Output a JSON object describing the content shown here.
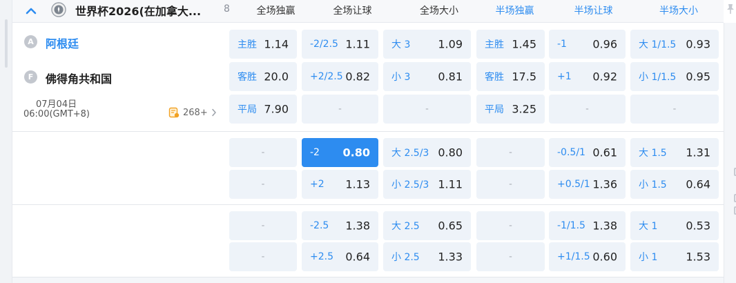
{
  "league": {
    "name": "世界杯2026(在加拿大...",
    "count": "8"
  },
  "columns": {
    "full_win": "全场独赢",
    "full_handicap": "全场让球",
    "full_total": "全场大小",
    "half_win": "半场独赢",
    "half_handicap": "半场让球",
    "half_total": "半场大小"
  },
  "match": {
    "home": {
      "badge": "A",
      "name": "阿根廷"
    },
    "away": {
      "badge": "F",
      "name": "佛得角共和国"
    },
    "date": "07月04日",
    "time": "06:00(GMT+8)",
    "more_markets": "268+"
  },
  "odds": [
    [
      {
        "label": "主胜",
        "value": "1.14"
      },
      {
        "label": "-2/2.5",
        "value": "1.11"
      },
      {
        "label": "大 3",
        "value": "1.09"
      },
      {
        "label": "主胜",
        "value": "1.45"
      },
      {
        "label": "-1",
        "value": "0.96"
      },
      {
        "label": "大 1/1.5",
        "value": "0.93"
      }
    ],
    [
      {
        "label": "客胜",
        "value": "20.0"
      },
      {
        "label": "+2/2.5",
        "value": "0.82"
      },
      {
        "label": "小 3",
        "value": "0.81"
      },
      {
        "label": "客胜",
        "value": "17.5"
      },
      {
        "label": "+1",
        "value": "0.92"
      },
      {
        "label": "小 1/1.5",
        "value": "0.95"
      }
    ],
    [
      {
        "label": "平局",
        "value": "7.90"
      },
      {
        "dash": "-"
      },
      {
        "dash": "-"
      },
      {
        "label": "平局",
        "value": "3.25"
      },
      {
        "dash": "-"
      },
      {
        "dash": "-"
      }
    ],
    [
      {
        "dash": "-"
      },
      {
        "label": "-2",
        "value": "0.80",
        "selected": true
      },
      {
        "label": "大 2.5/3",
        "value": "0.80"
      },
      {
        "dash": "-"
      },
      {
        "label": "-0.5/1",
        "value": "0.61"
      },
      {
        "label": "大 1.5",
        "value": "1.31"
      }
    ],
    [
      {
        "dash": "-"
      },
      {
        "label": "+2",
        "value": "1.13"
      },
      {
        "label": "小 2.5/3",
        "value": "1.11"
      },
      {
        "dash": "-"
      },
      {
        "label": "+0.5/1",
        "value": "1.36"
      },
      {
        "label": "小 1.5",
        "value": "0.64"
      }
    ],
    [
      {
        "dash": "-"
      },
      {
        "label": "-2.5",
        "value": "1.38"
      },
      {
        "label": "大 2.5",
        "value": "0.65"
      },
      {
        "dash": "-"
      },
      {
        "label": "-1/1.5",
        "value": "1.38"
      },
      {
        "label": "大 1",
        "value": "0.53"
      }
    ],
    [
      {
        "dash": "-"
      },
      {
        "label": "+2.5",
        "value": "0.64"
      },
      {
        "label": "小 2.5",
        "value": "1.33"
      },
      {
        "dash": "-"
      },
      {
        "label": "+1/1.5",
        "value": "0.60"
      },
      {
        "label": "小 1",
        "value": "1.53"
      }
    ]
  ],
  "colors": {
    "accent": "#2d8cf0",
    "cell_bg": "#eef3f9",
    "selected_bg": "#2d8cf0"
  },
  "icons": [
    "chevron-up-icon",
    "league-emblem-icon",
    "pin-icon",
    "more-markets-icon",
    "chevron-right-icon"
  ]
}
